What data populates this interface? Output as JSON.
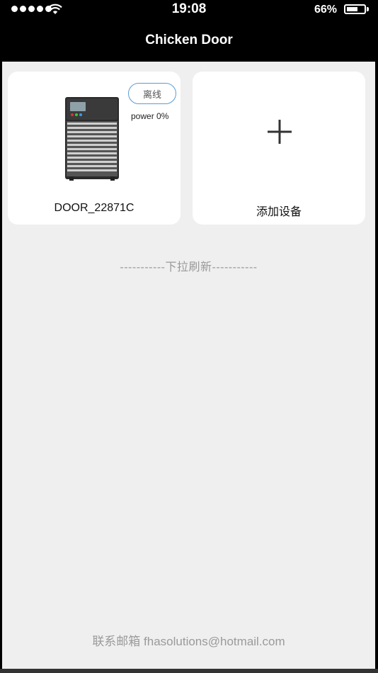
{
  "status_bar": {
    "time": "19:08",
    "battery_percent": "66%",
    "battery_level": 0.66,
    "signal_bars": 5
  },
  "nav": {
    "title": "Chicken Door"
  },
  "devices": [
    {
      "name": "DOOR_22871C",
      "status": "离线",
      "power": "power 0%",
      "status_color": "#5b9bd5"
    }
  ],
  "add_device": {
    "label": "添加设备",
    "icon": "plus-icon"
  },
  "pull_refresh_text": "-----------下拉刷新-----------",
  "footer_text": "联系邮箱 fhasolutions@hotmail.com",
  "colors": {
    "background": "#efefef",
    "header": "#000000",
    "card": "#ffffff"
  }
}
